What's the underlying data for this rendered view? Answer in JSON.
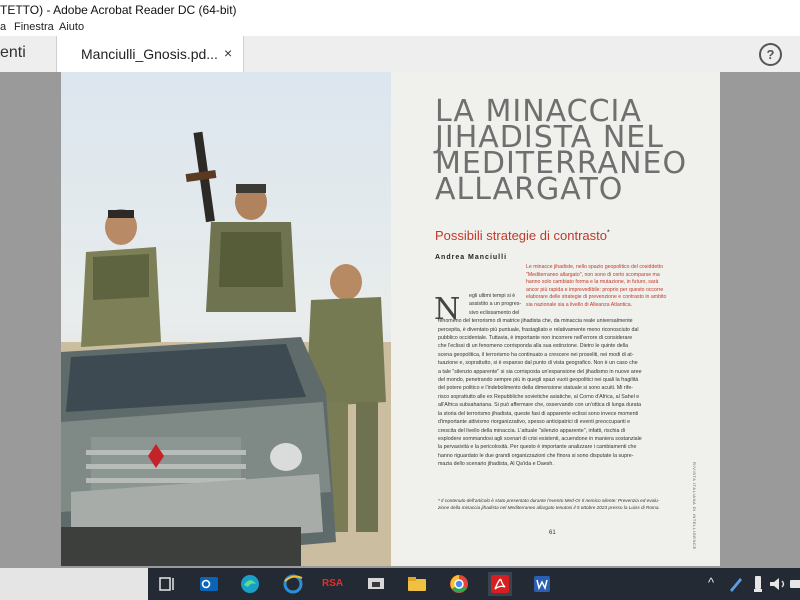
{
  "window": {
    "title": "TETTO) - Adobe Acrobat Reader DC (64-bit)"
  },
  "menu": {
    "items": [
      "a",
      "Finestra",
      "Aiuto"
    ]
  },
  "tabs": {
    "tools_label": "enti",
    "document_label": "Manciulli_Gnosis.pd...",
    "close_glyph": "×"
  },
  "help": {
    "glyph": "?"
  },
  "article": {
    "title_lines": [
      "LA MINACCIA",
      "JIHADISTA NEL",
      "MEDITERRANEO",
      "ALLARGATO"
    ],
    "subtitle": "Possibili strategie di contrasto",
    "subtitle_mark": "*",
    "author": "Andrea Manciulli",
    "abstract_lines": [
      "Le minacce jihadiste, nello spazio geopolitico del cosiddetto",
      "\"Mediterraneo allargato\", non sono di certo scomparse ma",
      "hanno solo cambiato forma e la mutazione, in futuro, sarà",
      "ancor più rapida e imprevedibile: proprio per questo occorre",
      "elaborare delle strategie di prevenzione e contrasto in ambito",
      "sia nazionale sia a livello di Alleanza Atlantica."
    ],
    "dropcap": "N",
    "body_indented": [
      "egli ultimi tempi si è",
      "assistito a un progres-",
      "sivo eclissamento del"
    ],
    "body_lines": [
      "fenomeno del terrorismo di matrice jihadista che, da minaccia reale universalmente",
      "percepita, è diventato più puntuale, frastagliato e relativamente meno riconosciuto dal",
      "pubblico occidentale. Tuttavia, è importante non incorrere nell'errore di considerare",
      "che l'eclissi di un fenomeno corrisponda alla sua estinzione. Dietro le quinte della",
      "scena geopolitica, il terrorismo ha continuato a crescere nei proseliti, nei modi di at-",
      "tuazione e, soprattutto, si è espanso dal punto di vista geografico. Non è un caso che",
      "a tale \"silenzio apparente\" si sia corrisposta un'espansione del jihadismo in nuove aree",
      "del mondo, penetrando sempre più in quegli spazi vuoti geopolitici nei quali la fragilità",
      "del potere politico e l'indebolimento della dimensione statuale si sono acuiti. Mi rife-",
      "risco soprattutto alle ex Repubbliche sovietiche asiatiche, al Corno d'Africa, al Sahel e",
      "all'Africa subsahariana. Si può affermare che, osservando con un'ottica di lunga durata",
      "la storia del terrorismo jihadista, queste fasi di apparente eclissi sono invece momenti",
      "d'importante attivismo riorganizzativo, spesso anticipatrici di eventi preoccupanti e",
      "crescita del livello della minaccia. L'attuale \"silenzio apparente\", infatti, rischia di",
      "esplodere sommandosi agli scenari di crisi esistenti, acuendone in maniera sostanziale",
      "la pervasività e la pericolosità. Per questo è importante analizzare i cambiamenti che",
      "hanno riguardato le due grandi organizzazioni che finora si sono disputate la supre-",
      "mazia dello scenario jihadista, Al Qa'ida e Daesh."
    ],
    "footnote_lines": [
      "* Il contenuto dell'articolo è stato presentato durante l'evento Med-Or Il nemico silente: Prevenzia ed evolu-",
      "zione della minaccia jihadista nel Mediterraneo allargato tenutosi il 5 ottobre 2023 presso la Luiss di Roma."
    ],
    "page_number": "61",
    "side_text": "RIVISTA ITALIANA DI INTELLIGENCE"
  },
  "taskbar": {
    "rsa_label": "RSA",
    "tray_chevron": "^",
    "colors": {
      "outlook": "#0a64b8",
      "edge": "#1aa0c8",
      "ie": "#2e8fd9",
      "rsa": "#e03030",
      "explorer": "#f0c040",
      "chrome": "#e5443a",
      "acrobat": "#d81e1e",
      "word": "#2b5fb3"
    }
  }
}
